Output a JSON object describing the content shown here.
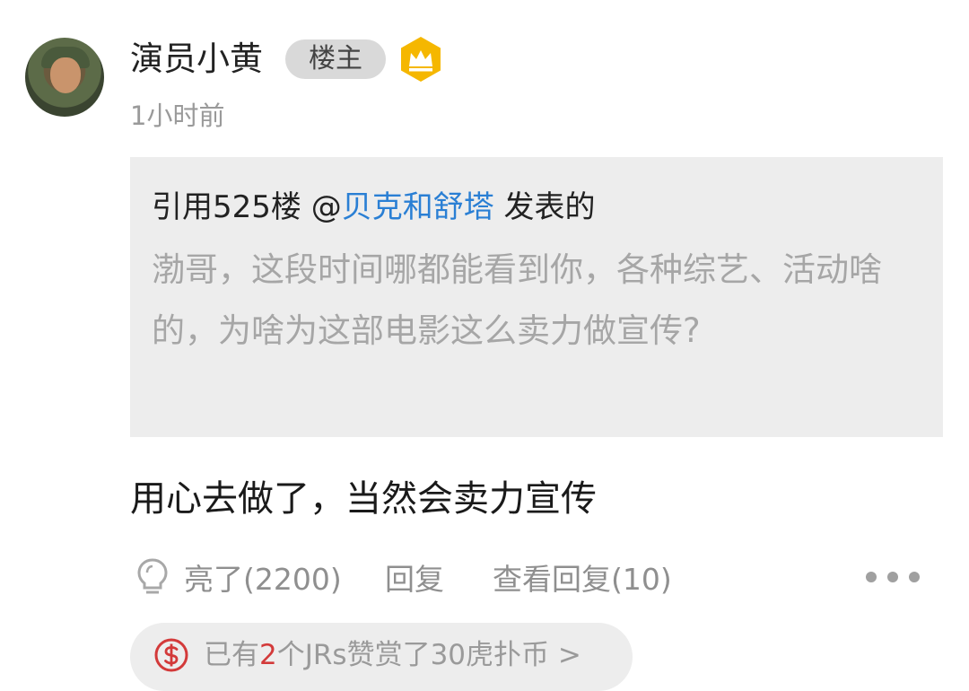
{
  "post": {
    "username": "演员小黄",
    "owner_badge": "楼主",
    "time": "1小时前",
    "quote": {
      "prefix": "引用525楼 @",
      "quoted_user": "贝克和舒塔",
      "suffix": " 发表的",
      "text": "渤哥，这段时间哪都能看到你，各种综艺、活动啥的，为啥为这部电影这么卖力做宣传?"
    },
    "reply_text": "用心去做了，当然会卖力宣传",
    "actions": {
      "light_label": "亮了(2200)",
      "reply_label": "回复",
      "view_replies_label": "查看回复(10)"
    },
    "reward": {
      "prefix": "已有",
      "count": "2",
      "suffix": "个JRs赞赏了30虎扑币 >"
    }
  },
  "colors": {
    "link_blue": "#2a7fd4",
    "crown_yellow": "#f5b700",
    "reward_red": "#d33a3a"
  },
  "icons": {
    "crown": "crown-icon",
    "light": "lightbulb-icon",
    "more": "more-dots-icon",
    "reward": "coin-icon"
  }
}
